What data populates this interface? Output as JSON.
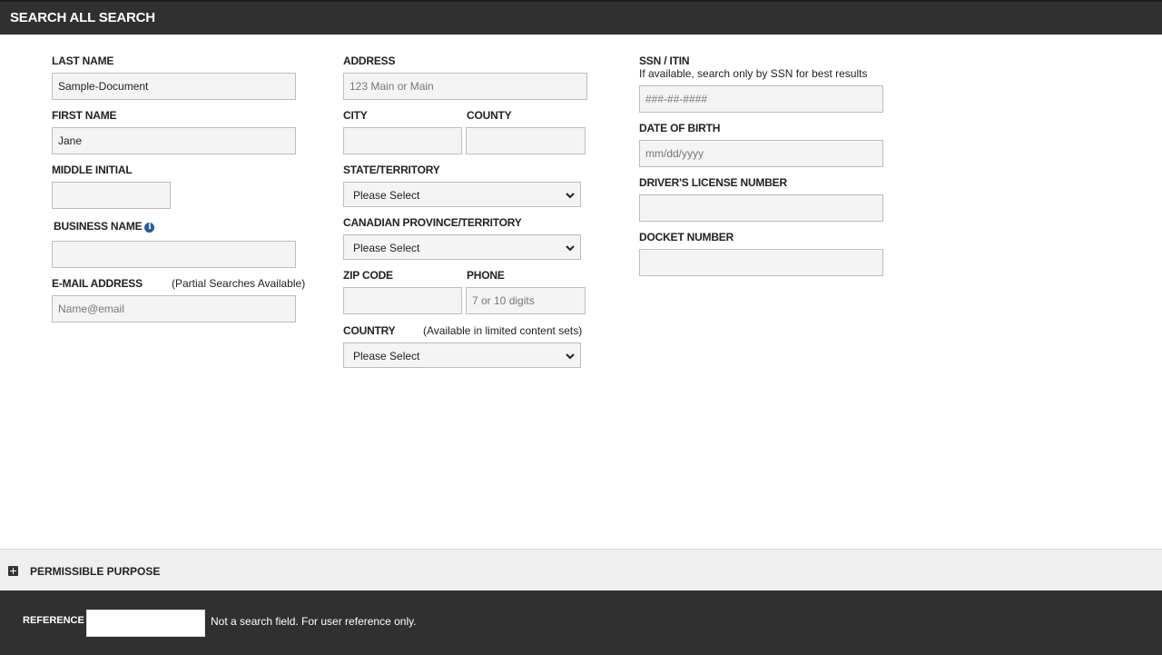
{
  "header": {
    "title": "SEARCH ALL SEARCH"
  },
  "col1": {
    "last_name": {
      "label": "LAST NAME",
      "value": "Sample-Document"
    },
    "first_name": {
      "label": "FIRST NAME",
      "value": "Jane"
    },
    "middle_initial": {
      "label": "MIDDLE INITIAL",
      "value": ""
    },
    "business_name": {
      "label": "BUSINESS NAME",
      "value": "",
      "icon": "info-icon"
    },
    "email": {
      "label": "E-MAIL ADDRESS",
      "note": "(Partial Searches Available)",
      "placeholder": "Name@email"
    }
  },
  "col2": {
    "address": {
      "label": "ADDRESS",
      "placeholder": "123 Main or Main"
    },
    "city": {
      "label": "CITY",
      "value": ""
    },
    "county": {
      "label": "COUNTY",
      "value": ""
    },
    "state": {
      "label": "STATE/TERRITORY",
      "selected": "Please Select"
    },
    "province": {
      "label": "CANADIAN PROVINCE/TERRITORY",
      "selected": "Please Select"
    },
    "zip": {
      "label": "ZIP CODE",
      "value": ""
    },
    "phone": {
      "label": "PHONE",
      "placeholder": "7 or 10 digits"
    },
    "country": {
      "label": "COUNTRY",
      "note": "(Available in limited content sets)",
      "selected": "Please Select"
    }
  },
  "col3": {
    "ssn": {
      "label": "SSN / ITIN",
      "note": "If available, search only by SSN for best results",
      "placeholder": "###-##-####"
    },
    "dob": {
      "label": "DATE OF BIRTH",
      "placeholder": "mm/dd/yyyy"
    },
    "license": {
      "label": "DRIVER'S LICENSE NUMBER",
      "value": ""
    },
    "docket": {
      "label": "DOCKET NUMBER",
      "value": ""
    }
  },
  "permissible_purpose": {
    "label": "PERMISSIBLE PURPOSE",
    "icon": "expand-plus-icon"
  },
  "footer": {
    "reference_label": "REFERENCE",
    "reference_value": "",
    "note": "Not a search field. For user reference only."
  },
  "colors": {
    "header_bg": "#303030",
    "field_bg": "#f4f4f4",
    "field_border": "#bdbdbd",
    "purpose_bg": "#efefef",
    "info_icon": "#1f5fa8"
  }
}
